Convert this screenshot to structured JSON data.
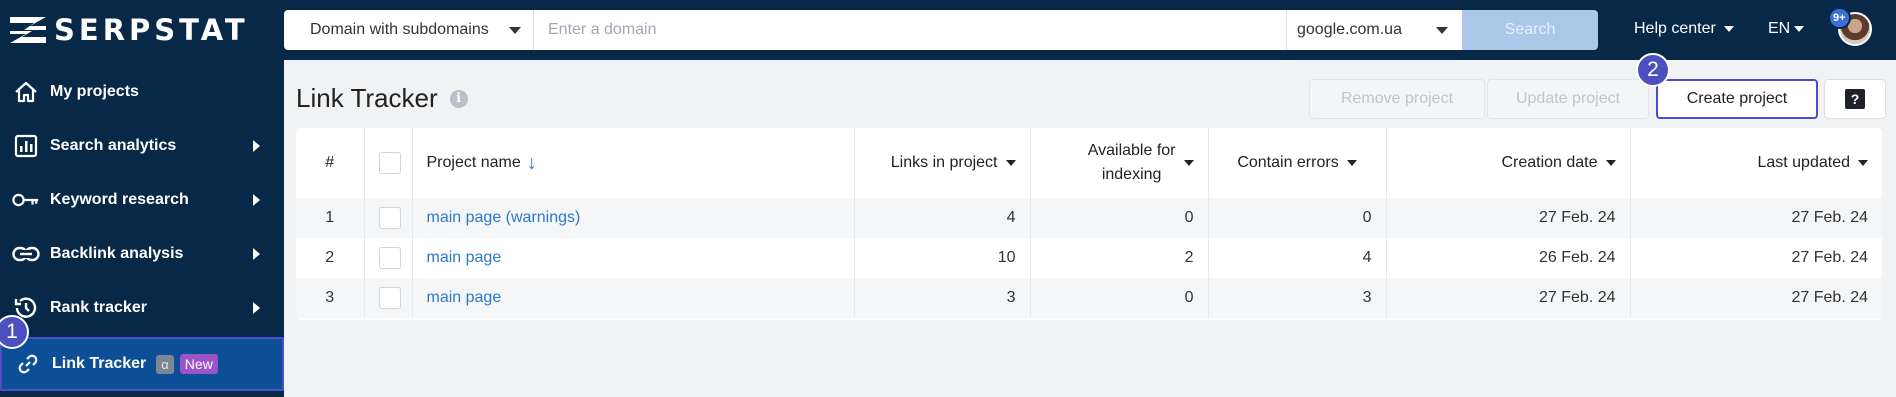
{
  "brand": {
    "name": "SERPSTAT"
  },
  "search": {
    "scope_value": "Domain with subdomains",
    "domain_placeholder": "Enter a domain",
    "domain_value": "",
    "search_engine": "google.com.ua",
    "search_button": "Search"
  },
  "header": {
    "help_center": "Help center",
    "language": "EN",
    "notifications_badge": "9+"
  },
  "sidebar": {
    "items": [
      {
        "label": "My projects",
        "icon": "home-icon",
        "has_arrow": false
      },
      {
        "label": "Search analytics",
        "icon": "chart-icon",
        "has_arrow": true
      },
      {
        "label": "Keyword research",
        "icon": "key-icon",
        "has_arrow": true
      },
      {
        "label": "Backlink analysis",
        "icon": "link-icon",
        "has_arrow": true
      },
      {
        "label": "Rank tracker",
        "icon": "history-icon",
        "has_arrow": true
      },
      {
        "label": "Link Tracker",
        "icon": "chain-icon",
        "active": true,
        "tag_alpha": "α",
        "tag_new": "New"
      }
    ]
  },
  "steps": {
    "step1": "1",
    "step2": "2"
  },
  "page": {
    "title": "Link Tracker",
    "info_icon": "i",
    "remove_project": "Remove project",
    "update_project": "Update project",
    "create_project": "Create project",
    "help_button": "?"
  },
  "table": {
    "columns": {
      "index": "#",
      "project_name": "Project name",
      "links_in_project": "Links in project",
      "available_line1": "Available for",
      "available_line2": "indexing",
      "contain_errors": "Contain errors",
      "creation_date": "Creation date",
      "last_updated": "Last updated"
    },
    "rows": [
      {
        "index": "1",
        "project_name": "main page (warnings)",
        "links": "4",
        "available": "0",
        "errors": "0",
        "created": "27 Feb. 24",
        "updated": "27 Feb. 24"
      },
      {
        "index": "2",
        "project_name": "main page",
        "links": "10",
        "available": "2",
        "errors": "4",
        "created": "26 Feb. 24",
        "updated": "27 Feb. 24"
      },
      {
        "index": "3",
        "project_name": "main page",
        "links": "3",
        "available": "0",
        "errors": "3",
        "created": "27 Feb. 24",
        "updated": "27 Feb. 24"
      }
    ]
  },
  "colors": {
    "navy": "#082847",
    "active_nav": "#0d4f96",
    "accent_outline": "#4a4fc4",
    "link": "#2e79c7",
    "new_tag": "#9b54c9"
  }
}
